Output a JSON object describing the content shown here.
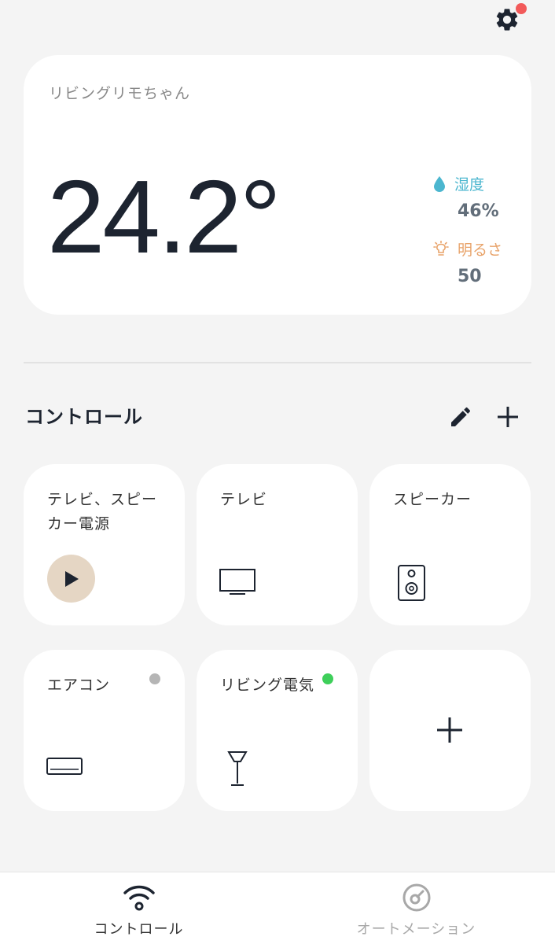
{
  "header": {
    "settings_icon": "gear-icon",
    "notification_color": "#f25a5a"
  },
  "sensor": {
    "device_name": "リビングリモちゃん",
    "temperature": "24.2°",
    "humidity_label": "湿度",
    "humidity_value": "46%",
    "brightness_label": "明るさ",
    "brightness_value": "50",
    "humidity_color": "#4bb6cf",
    "brightness_color": "#e8a36a"
  },
  "controls": {
    "title": "コントロール",
    "tiles": [
      {
        "label": "テレビ、スピーカー電源",
        "icon": "play-icon"
      },
      {
        "label": "テレビ",
        "icon": "tv-icon"
      },
      {
        "label": "スピーカー",
        "icon": "speaker-icon"
      },
      {
        "label": "エアコン",
        "icon": "air-conditioner-icon",
        "status": "off",
        "status_color": "#b5b5b5"
      },
      {
        "label": "リビング電気",
        "icon": "lamp-icon",
        "status": "on",
        "status_color": "#3ecf5a"
      },
      {
        "label": "",
        "icon": "plus-icon"
      }
    ]
  },
  "nav": {
    "items": [
      {
        "label": "コントロール",
        "icon": "wifi-icon",
        "active": true
      },
      {
        "label": "オートメーション",
        "icon": "gauge-icon",
        "active": false
      }
    ]
  }
}
